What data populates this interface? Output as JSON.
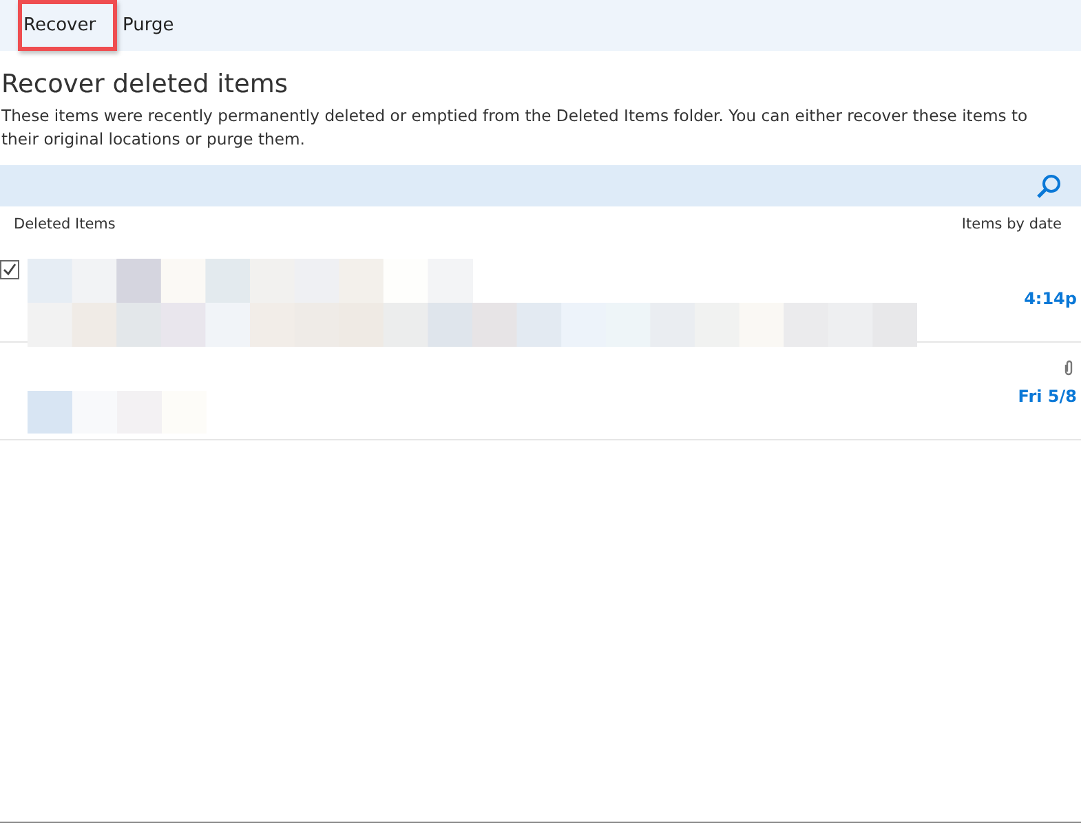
{
  "toolbar": {
    "actions": [
      {
        "label": "Recover",
        "highlighted": true
      },
      {
        "label": "Purge",
        "highlighted": false
      }
    ]
  },
  "heading": "Recover deleted items",
  "description": "These items were recently permanently deleted or emptied from the Deleted Items folder. You can either recover these items to their original locations or purge them.",
  "list_header": {
    "folder": "Deleted Items",
    "sort": "Items by date"
  },
  "items": [
    {
      "checked": true,
      "attachment": false,
      "time": "4:14p"
    },
    {
      "checked": false,
      "attachment": true,
      "time": "Fri 5/8"
    }
  ]
}
